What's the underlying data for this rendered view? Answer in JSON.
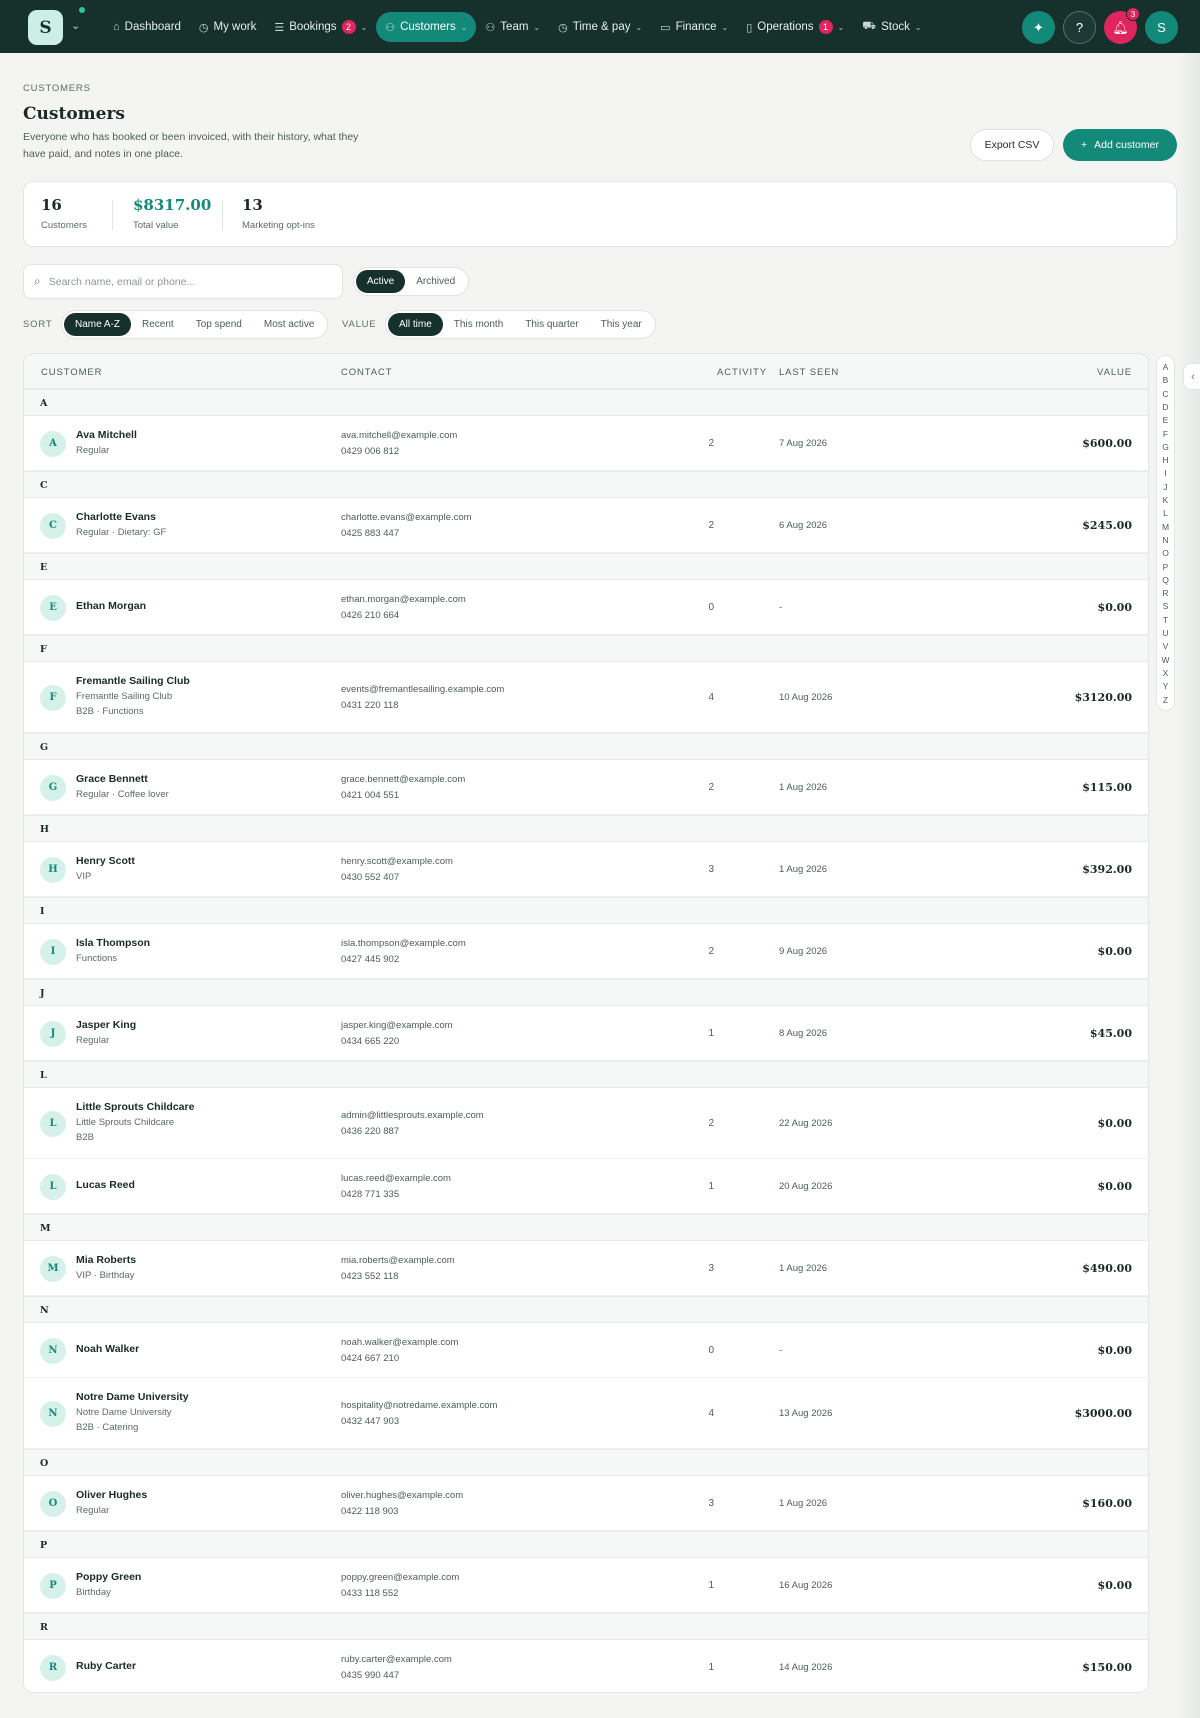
{
  "app": {
    "logo_letter": "S",
    "avatar_letter": "S",
    "notifications": "3"
  },
  "nav": [
    {
      "label": "Dashboard",
      "icon": "home-icon",
      "glyph": "⌂"
    },
    {
      "label": "My work",
      "icon": "clock-icon",
      "glyph": "◷"
    },
    {
      "label": "Bookings",
      "icon": "list-icon",
      "glyph": "☰",
      "badge": "2",
      "dropdown": true
    },
    {
      "label": "Customers",
      "icon": "users-icon",
      "glyph": "⚇",
      "dropdown": true,
      "active": true
    },
    {
      "label": "Team",
      "icon": "team-icon",
      "glyph": "⚇",
      "dropdown": true
    },
    {
      "label": "Time & pay",
      "icon": "clock-icon",
      "glyph": "◷",
      "dropdown": true
    },
    {
      "label": "Finance",
      "icon": "wallet-icon",
      "glyph": "▭",
      "dropdown": true
    },
    {
      "label": "Operations",
      "icon": "clipboard-icon",
      "glyph": "▯",
      "badge": "1",
      "dropdown": true
    },
    {
      "label": "Stock",
      "icon": "cart-icon",
      "glyph": "⛟",
      "dropdown": true
    }
  ],
  "header": {
    "eyebrow": "CUSTOMERS",
    "title": "Customers",
    "subtitle": "Everyone who has booked or been invoiced, with their history, what they have paid, and notes in one place.",
    "export_label": "Export CSV",
    "add_label": "Add customer"
  },
  "stats": [
    {
      "value": "16",
      "label": "Customers"
    },
    {
      "value": "$8317.00",
      "label": "Total value"
    },
    {
      "value": "13",
      "label": "Marketing opt-ins"
    }
  ],
  "search": {
    "placeholder": "Search name, email or phone..."
  },
  "status_filter": [
    "Active",
    "Archived"
  ],
  "sort": {
    "label": "SORT",
    "options": [
      "Name A-Z",
      "Recent",
      "Top spend",
      "Most active"
    ]
  },
  "value_filter": {
    "label": "VALUE",
    "options": [
      "All time",
      "This month",
      "This quarter",
      "This year"
    ]
  },
  "table": {
    "columns": [
      "CUSTOMER",
      "CONTACT",
      "ACTIVITY",
      "LAST SEEN",
      "VALUE"
    ],
    "groups": [
      {
        "letter": "A",
        "rows": [
          {
            "name": "Ava Mitchell",
            "tags": "Regular",
            "email": "ava.mitchell@example.com",
            "phone": "0429 006 812",
            "activity": "2",
            "last_seen": "7 Aug 2026",
            "value": "$600.00"
          }
        ]
      },
      {
        "letter": "C",
        "rows": [
          {
            "name": "Charlotte Evans",
            "tags": "Regular · Dietary: GF",
            "email": "charlotte.evans@example.com",
            "phone": "0425 883 447",
            "activity": "2",
            "last_seen": "6 Aug 2026",
            "value": "$245.00"
          }
        ]
      },
      {
        "letter": "E",
        "rows": [
          {
            "name": "Ethan Morgan",
            "email": "ethan.morgan@example.com",
            "phone": "0426 210 664",
            "activity": "0",
            "last_seen": "-",
            "value": "$0.00"
          }
        ]
      },
      {
        "letter": "F",
        "rows": [
          {
            "name": "Fremantle Sailing Club",
            "org": "Fremantle Sailing Club",
            "tags": "B2B · Functions",
            "email": "events@fremantlesailing.example.com",
            "phone": "0431 220 118",
            "activity": "4",
            "last_seen": "10 Aug 2026",
            "value": "$3120.00"
          }
        ]
      },
      {
        "letter": "G",
        "rows": [
          {
            "name": "Grace Bennett",
            "tags": "Regular · Coffee lover",
            "email": "grace.bennett@example.com",
            "phone": "0421 004 551",
            "activity": "2",
            "last_seen": "1 Aug 2026",
            "value": "$115.00"
          }
        ]
      },
      {
        "letter": "H",
        "rows": [
          {
            "name": "Henry Scott",
            "tags": "VIP",
            "email": "henry.scott@example.com",
            "phone": "0430 552 407",
            "activity": "3",
            "last_seen": "1 Aug 2026",
            "value": "$392.00"
          }
        ]
      },
      {
        "letter": "I",
        "rows": [
          {
            "name": "Isla Thompson",
            "tags": "Functions",
            "email": "isla.thompson@example.com",
            "phone": "0427 445 902",
            "activity": "2",
            "last_seen": "9 Aug 2026",
            "value": "$0.00"
          }
        ]
      },
      {
        "letter": "J",
        "rows": [
          {
            "name": "Jasper King",
            "tags": "Regular",
            "email": "jasper.king@example.com",
            "phone": "0434 665 220",
            "activity": "1",
            "last_seen": "8 Aug 2026",
            "value": "$45.00"
          }
        ]
      },
      {
        "letter": "L",
        "rows": [
          {
            "name": "Little Sprouts Childcare",
            "org": "Little Sprouts Childcare",
            "tags": "B2B",
            "email": "admin@littlesprouts.example.com",
            "phone": "0436 220 887",
            "activity": "2",
            "last_seen": "22 Aug 2026",
            "value": "$0.00"
          },
          {
            "name": "Lucas Reed",
            "email": "lucas.reed@example.com",
            "phone": "0428 771 335",
            "activity": "1",
            "last_seen": "20 Aug 2026",
            "value": "$0.00"
          }
        ]
      },
      {
        "letter": "M",
        "rows": [
          {
            "name": "Mia Roberts",
            "tags": "VIP · Birthday",
            "email": "mia.roberts@example.com",
            "phone": "0423 552 118",
            "activity": "3",
            "last_seen": "1 Aug 2026",
            "value": "$490.00"
          }
        ]
      },
      {
        "letter": "N",
        "rows": [
          {
            "name": "Noah Walker",
            "email": "noah.walker@example.com",
            "phone": "0424 667 210",
            "activity": "0",
            "last_seen": "-",
            "value": "$0.00"
          },
          {
            "name": "Notre Dame University",
            "org": "Notre Dame University",
            "tags": "B2B · Catering",
            "email": "hospitality@notredame.example.com",
            "phone": "0432 447 903",
            "activity": "4",
            "last_seen": "13 Aug 2026",
            "value": "$3000.00"
          }
        ]
      },
      {
        "letter": "O",
        "rows": [
          {
            "name": "Oliver Hughes",
            "tags": "Regular",
            "email": "oliver.hughes@example.com",
            "phone": "0422 118 903",
            "activity": "3",
            "last_seen": "1 Aug 2026",
            "value": "$160.00"
          }
        ]
      },
      {
        "letter": "P",
        "rows": [
          {
            "name": "Poppy Green",
            "tags": "Birthday",
            "email": "poppy.green@example.com",
            "phone": "0433 118 552",
            "activity": "1",
            "last_seen": "16 Aug 2026",
            "value": "$0.00"
          }
        ]
      },
      {
        "letter": "R",
        "rows": [
          {
            "name": "Ruby Carter",
            "email": "ruby.carter@example.com",
            "phone": "0435 990 447",
            "activity": "1",
            "last_seen": "14 Aug 2026",
            "value": "$150.00"
          }
        ]
      }
    ]
  },
  "alphabet": [
    "A",
    "B",
    "C",
    "D",
    "E",
    "F",
    "G",
    "H",
    "I",
    "J",
    "K",
    "L",
    "M",
    "N",
    "O",
    "P",
    "Q",
    "R",
    "S",
    "T",
    "U",
    "V",
    "W",
    "X",
    "Y",
    "Z"
  ]
}
